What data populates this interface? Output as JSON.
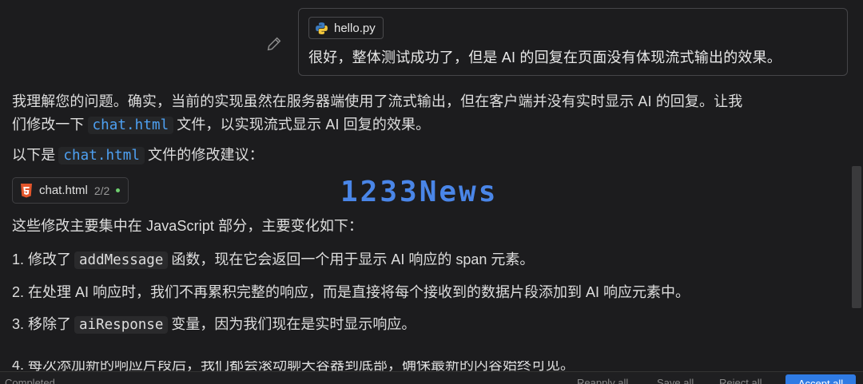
{
  "user_message": {
    "attachment": "hello.py",
    "text": "很好，整体测试成功了，但是 AI 的回复在页面没有体现流式输出的效果。"
  },
  "assistant": {
    "p1_a": "我理解您的问题。确实，当前的实现虽然在服务器端使用了流式输出，但在客户端并没有实时显示 AI 的回复。让我",
    "p1_b": "们修改一下",
    "p1_code": "chat.html",
    "p1_c": "文件，以实现流式显示 AI 回复的效果。",
    "p2_a": "以下是",
    "p2_code": "chat.html",
    "p2_b": "文件的修改建议：",
    "code_chip": {
      "filename": "chat.html",
      "count": "2/2"
    },
    "intro": "这些修改主要集中在 JavaScript 部分，主要变化如下：",
    "items": [
      {
        "pre": "1. 修改了",
        "code": "addMessage",
        "post": "函数，现在它会返回一个用于显示 AI 响应的 span 元素。"
      },
      {
        "pre": "2. 在处理 AI 响应时，我们不再累积完整的响应，而是直接将每个接收到的数据片段添加到 AI 响应元素中。"
      },
      {
        "pre": "3. 移除了",
        "code": "aiResponse",
        "post": "变量，因为我们现在是实时显示响应。"
      },
      {
        "pre": "4. 每次添加新的响应片段后，我们都会滚动聊天容器到底部，确保最新的内容始终可见。"
      }
    ]
  },
  "watermark": "1233News",
  "bottom_bar": {
    "status": "Completed",
    "reapply": "Reapply all",
    "save": "Save all",
    "reject": "Reject all",
    "accept": "Accept all"
  },
  "colors": {
    "accent": "#2f7be4",
    "code_text": "#4ea1f3",
    "background": "#1c1c1e"
  }
}
